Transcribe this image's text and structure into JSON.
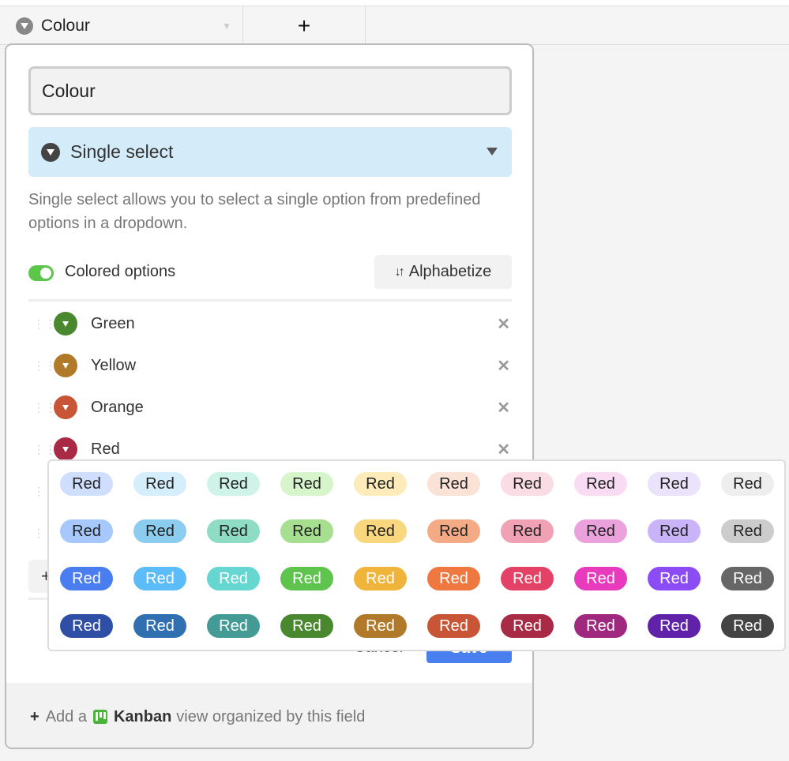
{
  "header": {
    "column_label": "Colour",
    "add_column": "+"
  },
  "panel": {
    "name_value": "Colour",
    "type_label": "Single select",
    "description": "Single select allows you to select a single option from predefined options in a dropdown.",
    "colored_options_label": "Colored options",
    "colored_options_on": true,
    "alphabetize_label": "Alphabetize",
    "options": [
      {
        "label": "Green",
        "color": "#4a882f"
      },
      {
        "label": "Yellow",
        "color": "#b07a2a"
      },
      {
        "label": "Orange",
        "color": "#c85535"
      },
      {
        "label": "Red",
        "color": "#a82a45"
      }
    ],
    "add_option": "+",
    "cancel_label": "Cancel",
    "save_label": "Save",
    "footer": {
      "plus": "+",
      "prefix": "Add a",
      "kanban": "Kanban",
      "suffix": "view organized by this field"
    }
  },
  "palette": {
    "chip_label": "Red",
    "rows": [
      {
        "text": "#222",
        "colors": [
          "#d0defe",
          "#d4eefc",
          "#cff3e9",
          "#d6f5cb",
          "#fdebb9",
          "#fbe2d6",
          "#fadde4",
          "#f9dcf3",
          "#ebe2fb",
          "#eeeeee"
        ]
      },
      {
        "text": "#222",
        "colors": [
          "#a6c8fd",
          "#8ccdef",
          "#8fdcc4",
          "#a6df8f",
          "#f9d77e",
          "#f4ab85",
          "#f0a1b4",
          "#eba1dc",
          "#c9b3f9",
          "#cccccc"
        ]
      },
      {
        "text": "#fff",
        "colors": [
          "#4a7ef0",
          "#5bbcf7",
          "#66d6d0",
          "#5ec44d",
          "#f0b43a",
          "#ee7840",
          "#e34266",
          "#e83abd",
          "#8b4cf5",
          "#666666"
        ]
      },
      {
        "text": "#fff",
        "colors": [
          "#2f4ea5",
          "#3070b0",
          "#449b95",
          "#4a882f",
          "#b07a2a",
          "#c85535",
          "#a82a45",
          "#a0287e",
          "#5f22a8",
          "#444444"
        ]
      }
    ]
  }
}
